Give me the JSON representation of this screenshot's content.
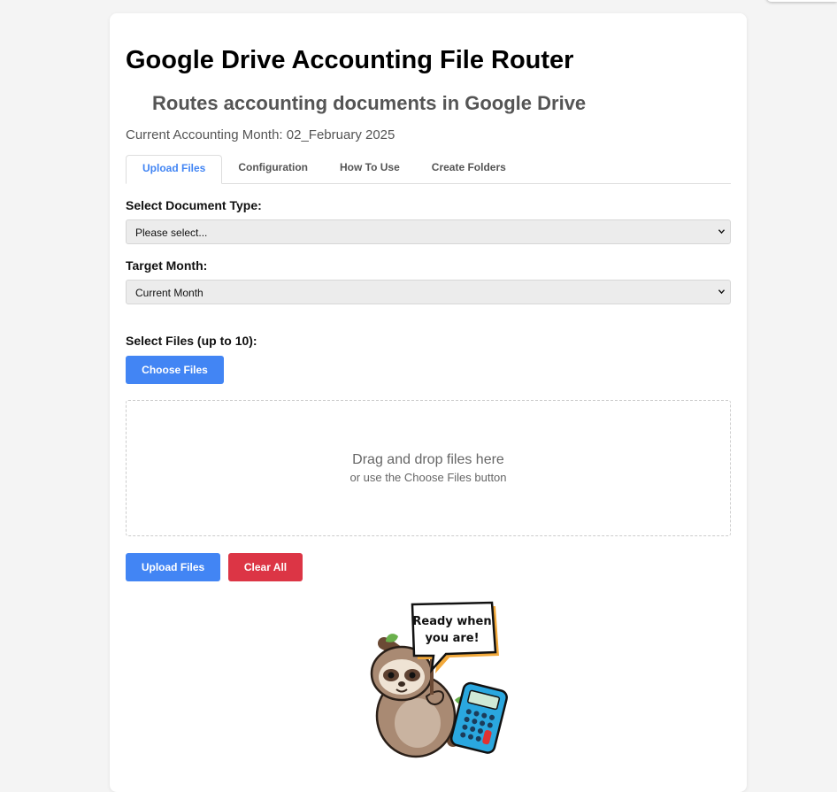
{
  "app": {
    "title": "Google Drive Accounting File Router",
    "subtitle": "Routes accounting documents in Google Drive",
    "current_month_text": "Current Accounting Month: 02_February 2025"
  },
  "tabs": [
    {
      "label": "Upload Files",
      "active": true
    },
    {
      "label": "Configuration",
      "active": false
    },
    {
      "label": "How To Use",
      "active": false
    },
    {
      "label": "Create Folders",
      "active": false
    }
  ],
  "form": {
    "doc_type_label": "Select Document Type:",
    "doc_type_value": "Please select...",
    "target_month_label": "Target Month:",
    "target_month_value": "Current Month",
    "select_files_label": "Select Files (up to 10):",
    "choose_files_button": "Choose Files"
  },
  "dropzone": {
    "main_text": "Drag and drop files here",
    "sub_text": "or use the Choose Files button"
  },
  "actions": {
    "upload_button": "Upload Files",
    "clear_button": "Clear All"
  },
  "mascot": {
    "icon": "sloth-with-calculator",
    "bubble_line1": "Ready when",
    "bubble_line2": "you are!"
  },
  "colors": {
    "accent": "#4285f4",
    "danger": "#dc3545",
    "background": "#f4f4f4"
  }
}
